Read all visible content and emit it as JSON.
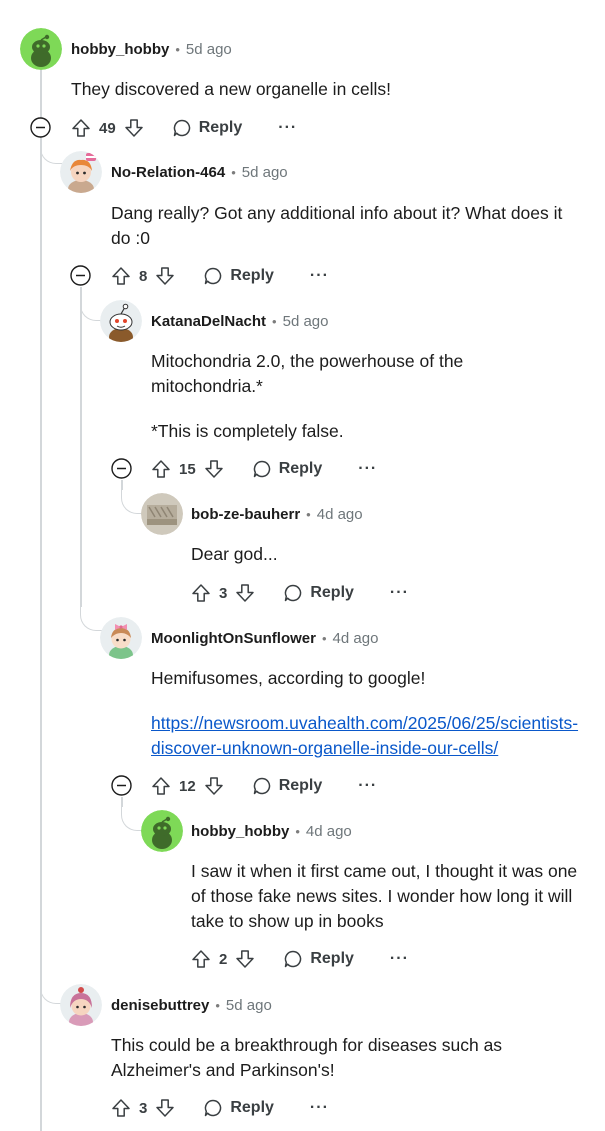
{
  "thread": {
    "comments": [
      {
        "username": "hobby_hobby",
        "time": "5d ago",
        "body": [
          "They discovered a new organelle in cells!"
        ],
        "votes": "49",
        "reply_label": "Reply",
        "more_label": "···",
        "avatar": "snoo-green-avatar"
      },
      {
        "username": "No-Relation-464",
        "time": "5d ago",
        "body": [
          "Dang really? Got any additional info about it? What does it do :0"
        ],
        "votes": "8",
        "reply_label": "Reply",
        "more_label": "···",
        "avatar": "orange-hair-avatar"
      },
      {
        "username": "KatanaDelNacht",
        "time": "5d ago",
        "body": [
          "Mitochondria 2.0, the powerhouse of the mitochondria.*",
          "*This is completely false."
        ],
        "votes": "15",
        "reply_label": "Reply",
        "more_label": "···",
        "avatar": "snoo-brown-avatar"
      },
      {
        "username": "bob-ze-bauherr",
        "time": "4d ago",
        "body": [
          "Dear god..."
        ],
        "votes": "3",
        "reply_label": "Reply",
        "more_label": "···",
        "avatar": "photo-avatar"
      },
      {
        "username": "MoonlightOnSunflower",
        "time": "4d ago",
        "body": [
          "Hemifusomes, according to google!"
        ],
        "link": "https://newsroom.uvahealth.com/2025/06/25/scientists-discover-unknown-organelle-inside-our-cells/",
        "votes": "12",
        "reply_label": "Reply",
        "more_label": "···",
        "avatar": "pink-bow-avatar"
      },
      {
        "username": "hobby_hobby",
        "time": "4d ago",
        "body": [
          "I saw it when it first came out, I thought it was one of those fake news sites. I wonder how long it will take to show up in books"
        ],
        "votes": "2",
        "reply_label": "Reply",
        "more_label": "···",
        "avatar": "snoo-green-avatar"
      },
      {
        "username": "denisebuttrey",
        "time": "5d ago",
        "body": [
          "This could be a breakthrough for diseases such as Alzheimer's and Parkinson's!"
        ],
        "votes": "3",
        "reply_label": "Reply",
        "more_label": "···",
        "avatar": "pink-hair-avatar"
      }
    ],
    "dot_separator": "•"
  },
  "colors": {
    "thread_line": "#d3d7da",
    "link": "#0a58ca",
    "muted": "#6e767a",
    "snoo_green": "#7ed957"
  }
}
